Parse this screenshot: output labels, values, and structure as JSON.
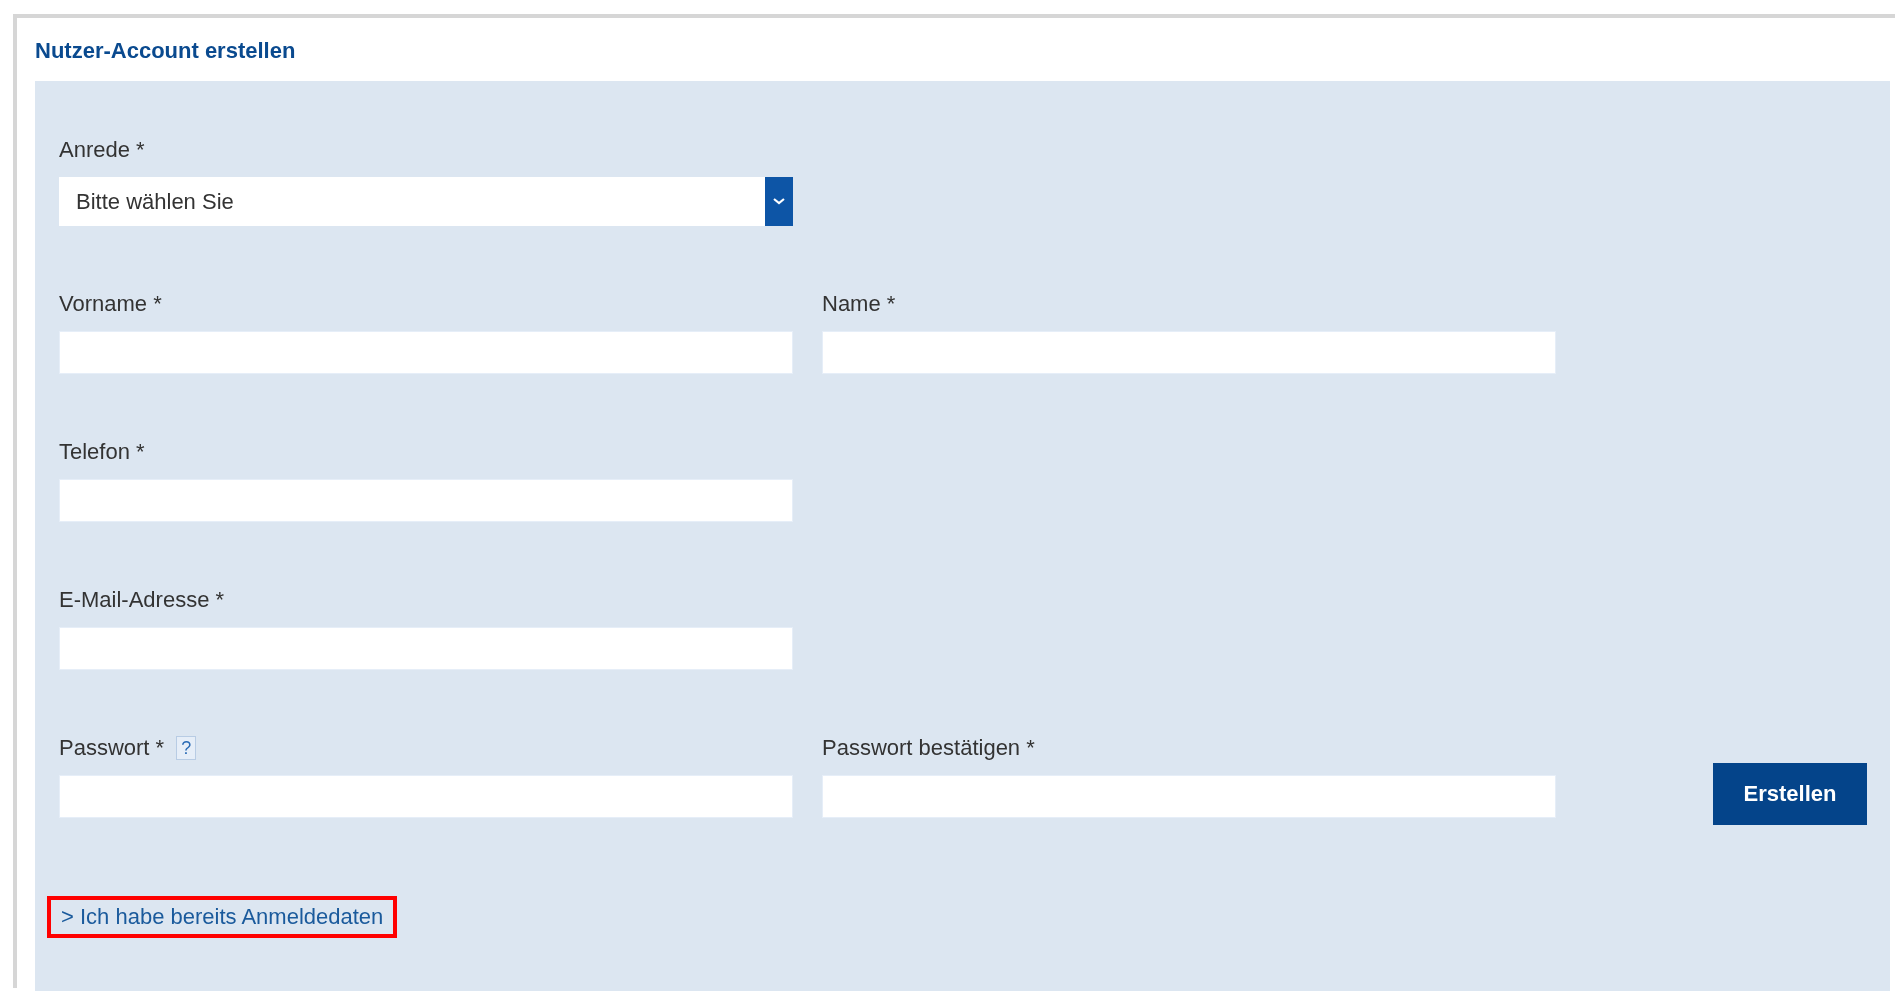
{
  "title": "Nutzer-Account erstellen",
  "rows": [
    {
      "fields": [
        {
          "kind": "select",
          "label": "Anrede *",
          "value": "Bitte wählen Sie"
        }
      ]
    },
    {
      "fields": [
        {
          "kind": "text",
          "label": "Vorname *"
        },
        {
          "kind": "text",
          "label": "Name *"
        }
      ]
    },
    {
      "fields": [
        {
          "kind": "text",
          "label": "Telefon *"
        }
      ]
    },
    {
      "fields": [
        {
          "kind": "text",
          "label": "E-Mail-Adresse *"
        }
      ]
    },
    {
      "fields": [
        {
          "kind": "password",
          "label": "Passwort *",
          "help": "?"
        },
        {
          "kind": "password",
          "label": "Passwort bestätigen *"
        }
      ]
    }
  ],
  "submit_button": {
    "label": "Erstellen"
  },
  "login_link": {
    "label": "> Ich habe bereits Anmeldedaten",
    "highlighted": true
  }
}
